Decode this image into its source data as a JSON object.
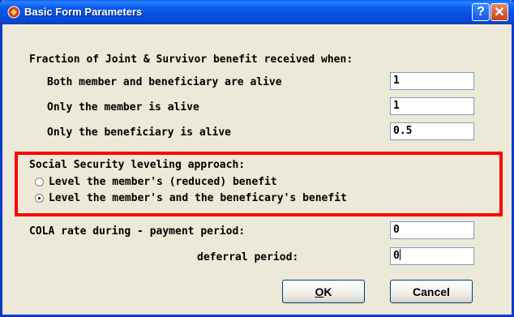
{
  "window": {
    "title": "Basic Form Parameters",
    "help_label": "?",
    "close_label": "✕"
  },
  "jas": {
    "heading": "Fraction of Joint & Survivor benefit received when:",
    "rows": [
      {
        "label": "Both member and beneficiary are alive",
        "value": "1"
      },
      {
        "label": "Only the member is alive",
        "value": "1"
      },
      {
        "label": "Only the beneficiary is alive",
        "value": "0.5"
      }
    ]
  },
  "ss": {
    "heading": "Social Security leveling approach:",
    "options": [
      {
        "label": "Level the member's (reduced) benefit",
        "checked": false
      },
      {
        "label": "Level the member's and the beneficary's benefit",
        "checked": true
      }
    ],
    "highlight_color": "#ff0000"
  },
  "cola": {
    "payment_label": "COLA rate during - payment period:",
    "payment_value": "0",
    "deferral_label": "deferral period:",
    "deferral_value": "0"
  },
  "buttons": {
    "ok_mnemonic": "O",
    "ok_rest": "K",
    "cancel": "Cancel"
  }
}
